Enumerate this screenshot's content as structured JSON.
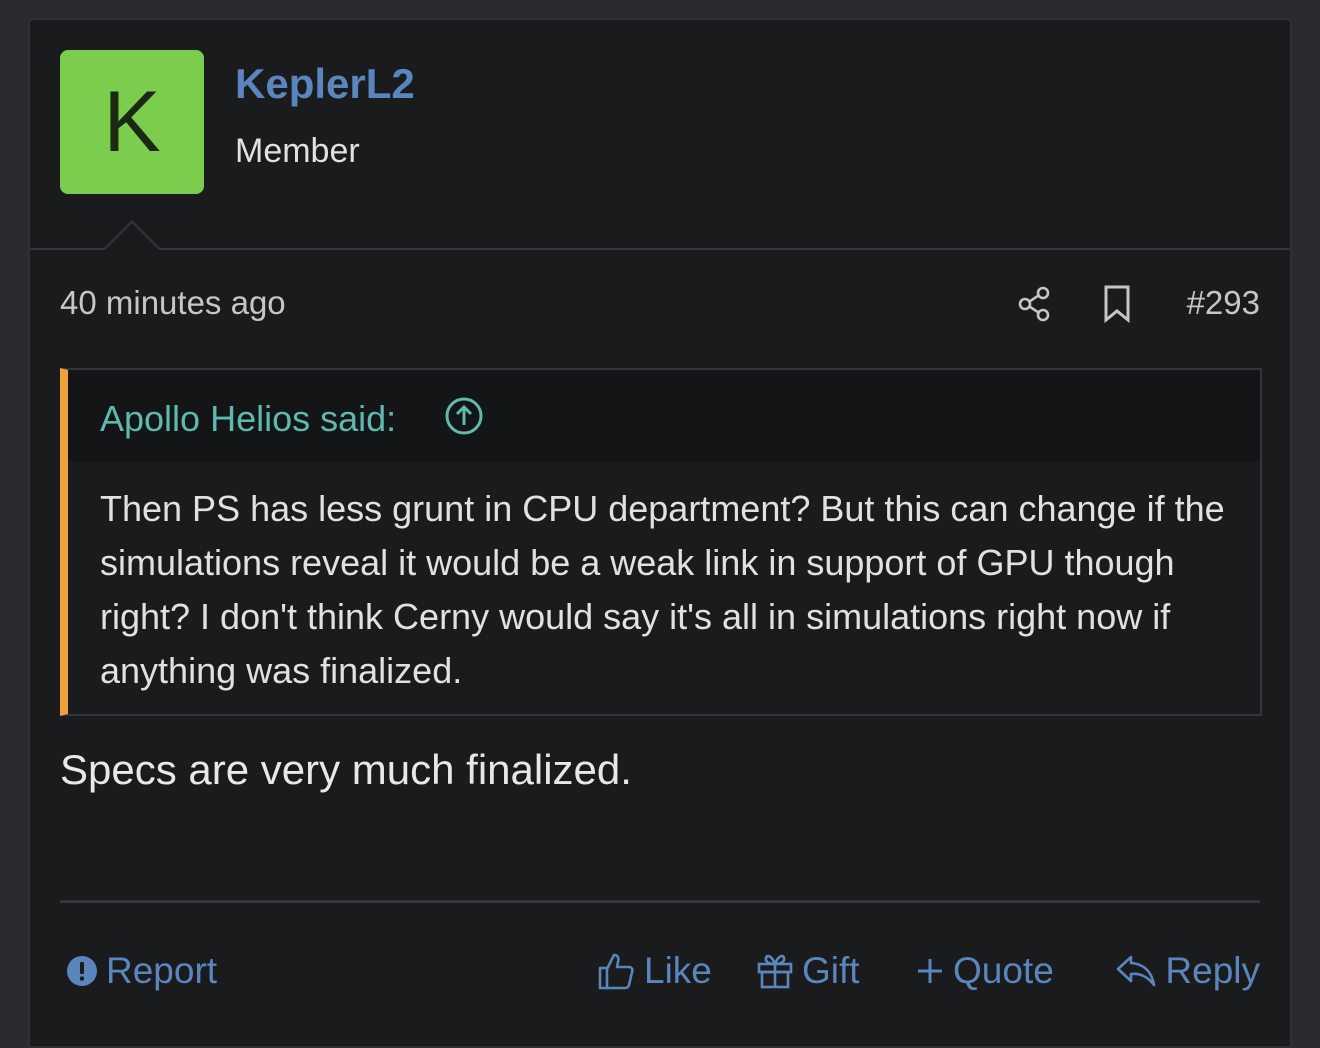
{
  "user": {
    "initial": "K",
    "avatar_color": "#7ccc4e",
    "username": "KeplerL2",
    "title": "Member"
  },
  "meta": {
    "timestamp": "40 minutes ago",
    "share_icon": "share-icon",
    "bookmark_icon": "bookmark-icon",
    "post_number": "#293"
  },
  "quote": {
    "author_line": "Apollo Helios said:",
    "jump_icon": "arrow-up-circle-icon",
    "accent_color": "#f0a13a",
    "text": "Then PS has less grunt in CPU department? But this can change if the simulations reveal it would be a weak link in support of GPU though right? I don't think Cerny would say it's all in simulations right now if anything was finalized."
  },
  "post": {
    "body": "Specs are very much finalized."
  },
  "actions": {
    "report": "Report",
    "like": "Like",
    "gift": "Gift",
    "quote": "Quote",
    "reply": "Reply"
  },
  "colors": {
    "link": "#5a86bd",
    "quote_author": "#5fb9b0",
    "background": "#1a1b1d"
  }
}
